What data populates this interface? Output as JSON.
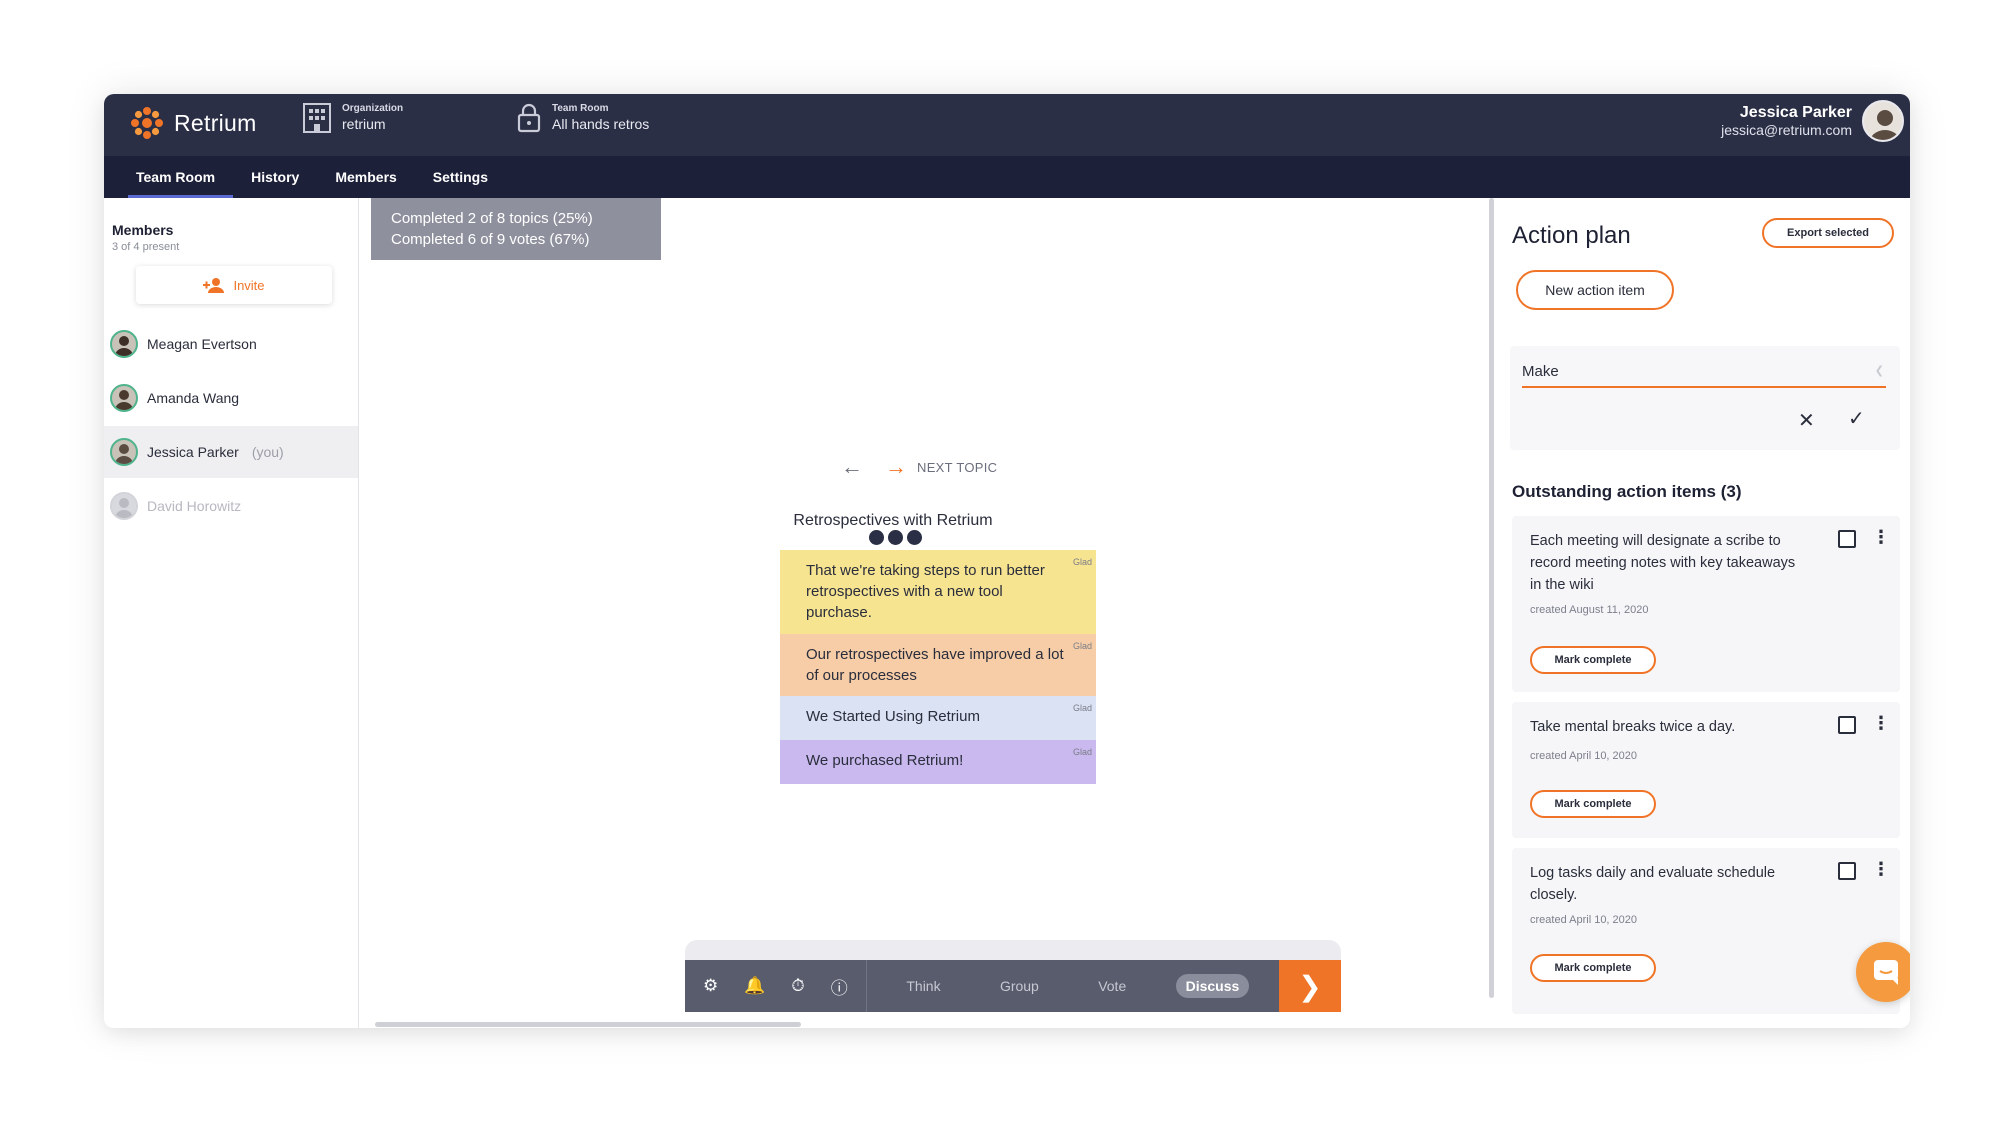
{
  "header": {
    "app_name": "Retrium",
    "organization": {
      "label": "Organization",
      "value": "retrium"
    },
    "team_room": {
      "label": "Team Room",
      "value": "All hands retros"
    },
    "user": {
      "name": "Jessica Parker",
      "email": "jessica@retrium.com"
    }
  },
  "nav": {
    "tabs": [
      {
        "label": "Team Room",
        "active": true
      },
      {
        "label": "History"
      },
      {
        "label": "Members"
      },
      {
        "label": "Settings"
      }
    ]
  },
  "members": {
    "title": "Members",
    "count": "3 of 4 present",
    "invite_label": "Invite",
    "list": [
      {
        "name": "Meagan Evertson"
      },
      {
        "name": "Amanda Wang"
      },
      {
        "name": "Jessica Parker",
        "you": "(you)"
      },
      {
        "name": "David Horowitz"
      }
    ]
  },
  "discuss": {
    "progress": {
      "topics": "Completed 2 of 8 topics (25%)",
      "votes": "Completed 6 of 9 votes (67%)"
    },
    "next_topic_label": "NEXT TOPIC",
    "topic_title": "Retrospectives with Retrium",
    "cards": [
      {
        "text": "That we're taking steps to run better retrospectives with a new tool purchase.",
        "tag": "Glad",
        "color": "#f7e491"
      },
      {
        "text": "Our retrospectives have improved a lot of our processes",
        "tag": "Glad",
        "color": "#f6cda7"
      },
      {
        "text": "We Started Using Retrium",
        "tag": "Glad",
        "color": "#dbe2f3"
      },
      {
        "text": "We purchased Retrium!",
        "tag": "Glad",
        "color": "#c9b9ee"
      }
    ]
  },
  "toolbar": {
    "phases": [
      {
        "label": "Think"
      },
      {
        "label": "Group"
      },
      {
        "label": "Vote"
      },
      {
        "label": "Discuss",
        "active": true
      }
    ],
    "accent": "#f07427"
  },
  "action_plan": {
    "title": "Action plan",
    "export_label": "Export selected",
    "new_item_label": "New action item",
    "editor_value": "Make",
    "outstanding_title": "Outstanding action items (3)",
    "mark_complete_label": "Mark complete",
    "items": [
      {
        "text": "Each meeting will designate a scribe to record meeting notes with key takeaways in the wiki",
        "created": "created August 11, 2020"
      },
      {
        "text": "Take mental breaks twice a day.",
        "created": "created April 10, 2020"
      },
      {
        "text": "Log tasks daily and evaluate schedule closely.",
        "created": "created April 10, 2020"
      }
    ]
  },
  "colors": {
    "header_bg": "#2b2f45",
    "nav_bg": "#1c2038",
    "accent": "#f07427",
    "online_ring": "#4fb38c"
  }
}
